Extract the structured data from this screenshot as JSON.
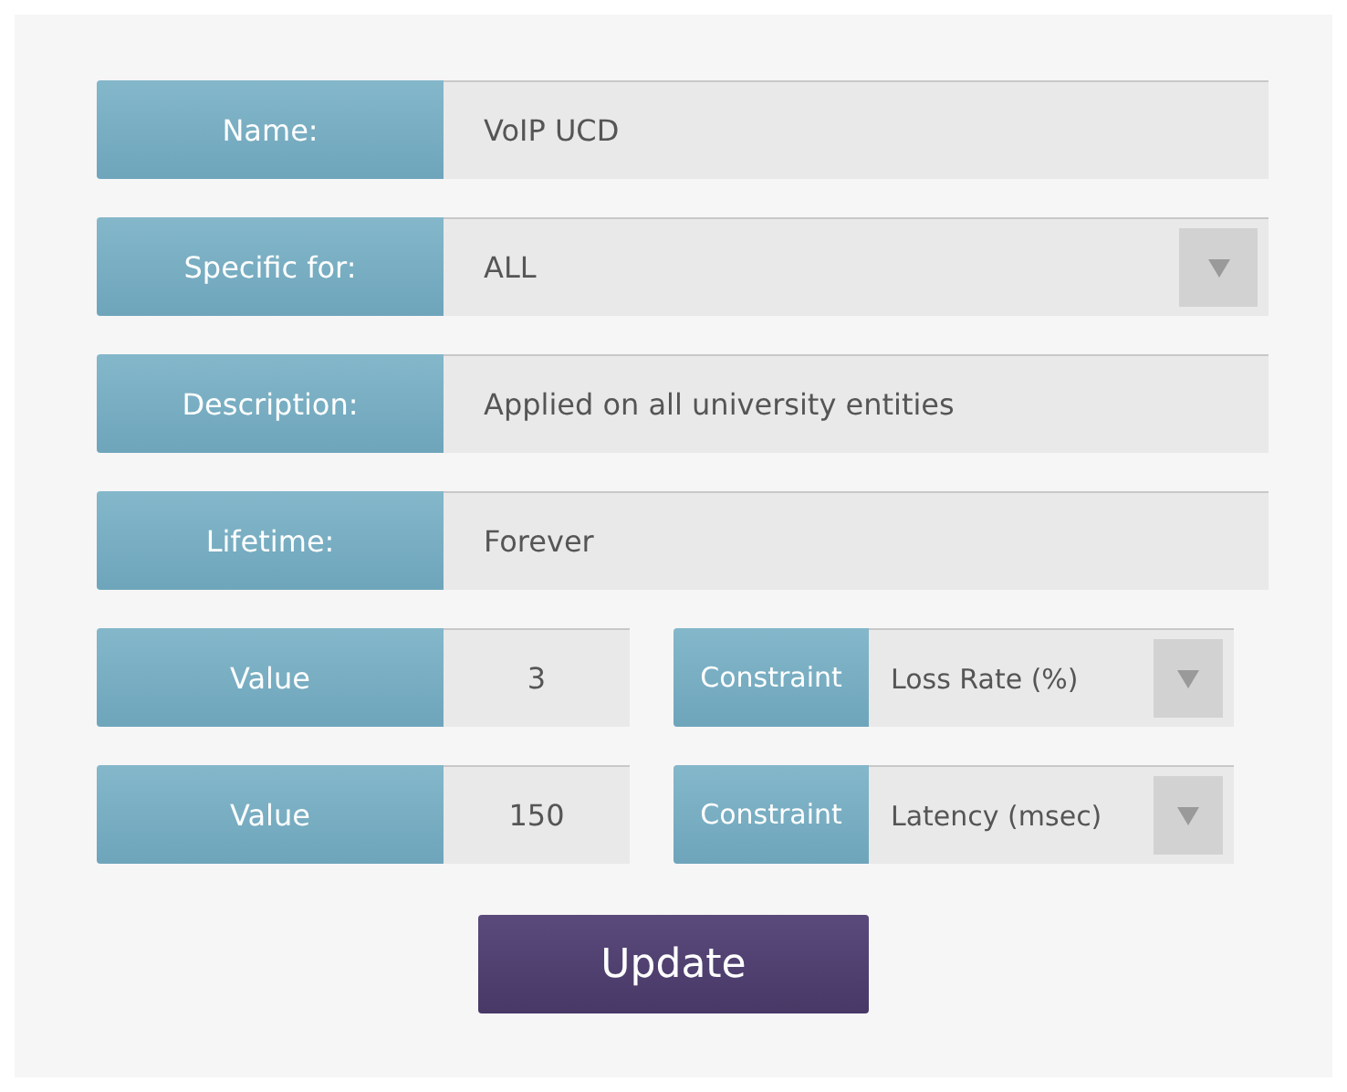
{
  "fields": [
    {
      "label": "Name:",
      "kind": "text",
      "value": "VoIP UCD"
    },
    {
      "label": "Specific for:",
      "kind": "select",
      "value": "ALL"
    },
    {
      "label": "Description:",
      "kind": "text",
      "value": "Applied on all university entities"
    },
    {
      "label": "Lifetime:",
      "kind": "text",
      "value": "Forever"
    }
  ],
  "constraints": [
    {
      "value_label": "Value",
      "value": "3",
      "constraint_label": "Constraint",
      "constraint": "Loss Rate (%)"
    },
    {
      "value_label": "Value",
      "value": "150",
      "constraint_label": "Constraint",
      "constraint": "Latency (msec)"
    }
  ],
  "button": "Update"
}
